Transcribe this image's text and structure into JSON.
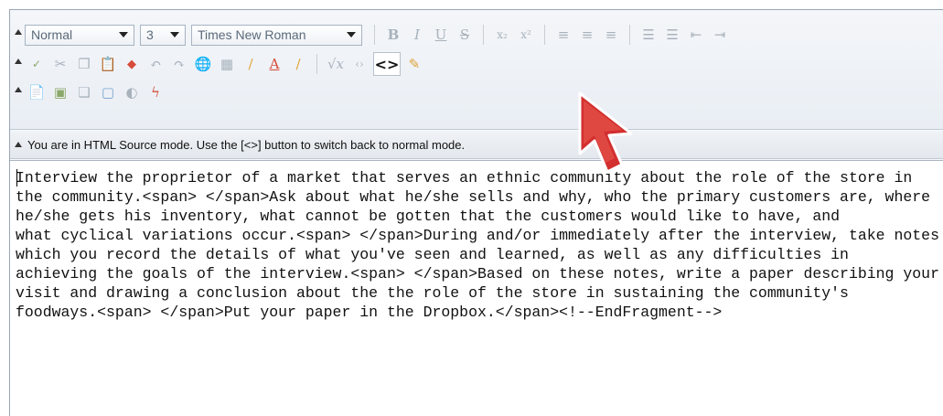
{
  "toolbar": {
    "style_select": "Normal",
    "size_select": "3",
    "font_select": "Times New Roman",
    "source_button_label": "<>"
  },
  "status_bar": {
    "message": "You are in HTML Source mode. Use the [<>] button to switch back to normal mode."
  },
  "source_editor": {
    "lines": [
      "Interview the proprietor of a market that serves an ethnic community about the role of the store in",
      "the community.<span> </span>Ask about what he/she sells and why, who the primary customers are, where",
      "he/she gets his inventory, what cannot be gotten that the customers would like to have, and",
      "what cyclical variations occur.<span> </span>During and/or immediately after the interview, take notes in",
      "which you record the details of what you've seen and learned, as well as any difficulties in",
      "achieving the goals of the interview.<span> </span>Based on these notes, write a paper describing your",
      "visit and drawing a conclusion about the the role of the store in sustaining the community's",
      "foodways.<span> </span>Put your paper in the Dropbox.</span><!--EndFragment-->"
    ]
  },
  "colors": {
    "accent_red": "#d32f2f",
    "toolbar_bg": "#eef2f6"
  }
}
